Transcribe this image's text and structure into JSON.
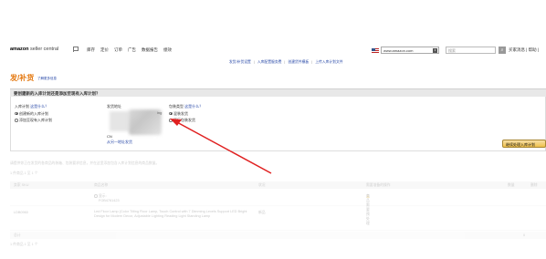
{
  "header": {
    "logo_main": "amazon",
    "logo_sub": " seller central",
    "nav": [
      "库存",
      "定价",
      "订单",
      "广告",
      "数据报告",
      "绩效"
    ],
    "store": "www.amazon.com",
    "search_placeholder": "搜索",
    "links": "买家消息 | 帮助 |"
  },
  "sublinks": [
    "发货/补货设置",
    "入库配置服务费",
    "创建货件模板",
    "上传入库计划文件"
  ],
  "page": {
    "title": "发/补货",
    "more_info": "了解更多信息"
  },
  "question": "要创建新的入库计划还是添加至现有入库计划？",
  "plan": {
    "label": "入库计划",
    "label_link": "这是什么？",
    "option_new": "创建新的入库计划",
    "option_existing": "添加至现有入库计划"
  },
  "address": {
    "label": "发货地址",
    "suffix": "ing",
    "country": "CN",
    "link": "从另一地址发货"
  },
  "packing": {
    "label": "包装类型",
    "label_link": "这是什么？",
    "option_mixed": "混装发货",
    "option_original": "原厂包装发货"
  },
  "continue_button": "继续处理入库计划",
  "note": "请提供你正在发货的各商品的装箱、包装要求信息，并在这里添加包含入库计划信息的商品数量。",
  "count_top": "1 件商品 1 至 1 个",
  "table": {
    "headers": [
      "卖家 SKU",
      "商品名称",
      "状况",
      "需要准备的操作",
      "数量",
      "删除"
    ],
    "row_a_text": "显示: FOB4761423",
    "row_a_info": "商品需要预处理",
    "row_b_sku": "LDB0960",
    "row_b_title": "Led Floor Lamp (Color Tilting Floor Lamp, Touch Control with 7 Dimming Levels Support LED Bright Design for Modern Decor, Adjustable Lighting Reading Light Standing Lamp",
    "row_b_condition": "新品",
    "footer_left": "总计",
    "footer_right": "0"
  },
  "count_bottom": "1 件商品 1 至 1 个",
  "colors": {
    "title": "#e47911",
    "link": "#2a4aa8",
    "arrow": "#e02020",
    "button": "#f0c14b"
  }
}
